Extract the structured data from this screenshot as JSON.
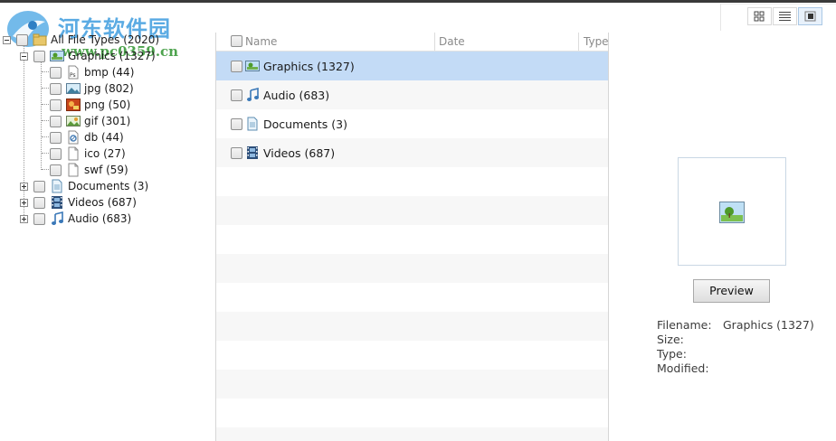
{
  "watermark": {
    "site_name": "河东软件园",
    "url": "www.pc0359.cn"
  },
  "tree": {
    "root": {
      "label": "All File Types (2020)"
    },
    "items": [
      {
        "label": "Graphics (1327)",
        "icon": "image-icon"
      },
      {
        "label": "bmp (44)",
        "icon": "bmp-file-icon"
      },
      {
        "label": "jpg (802)",
        "icon": "jpg-file-icon"
      },
      {
        "label": "png (50)",
        "icon": "png-file-icon"
      },
      {
        "label": "gif (301)",
        "icon": "gif-file-icon"
      },
      {
        "label": "db (44)",
        "icon": "db-file-icon"
      },
      {
        "label": "ico (27)",
        "icon": "blank-file-icon"
      },
      {
        "label": "swf (59)",
        "icon": "blank-file-icon"
      },
      {
        "label": "Documents (3)",
        "icon": "document-icon"
      },
      {
        "label": "Videos (687)",
        "icon": "film-icon"
      },
      {
        "label": "Audio (683)",
        "icon": "music-note-icon"
      }
    ]
  },
  "list": {
    "columns": [
      "Name",
      "Date",
      "Type"
    ],
    "rows": [
      {
        "name": "Graphics (1327)",
        "icon": "image-icon",
        "selected": true
      },
      {
        "name": "Audio (683)",
        "icon": "music-note-icon",
        "selected": false
      },
      {
        "name": "Documents (3)",
        "icon": "document-icon",
        "selected": false
      },
      {
        "name": "Videos (687)",
        "icon": "film-icon",
        "selected": false
      }
    ]
  },
  "view_buttons": [
    "grid-view-icon",
    "list-view-icon",
    "preview-pane-icon"
  ],
  "preview": {
    "button_label": "Preview",
    "filename_label": "Filename:",
    "filename_value": "Graphics (1327)",
    "size_label": "Size:",
    "type_label": "Type:",
    "modified_label": "Modified:"
  },
  "colors": {
    "selection": "#c3dbf6",
    "watermark_blue": "#4aa3e0",
    "watermark_green": "#3b9a3b"
  }
}
